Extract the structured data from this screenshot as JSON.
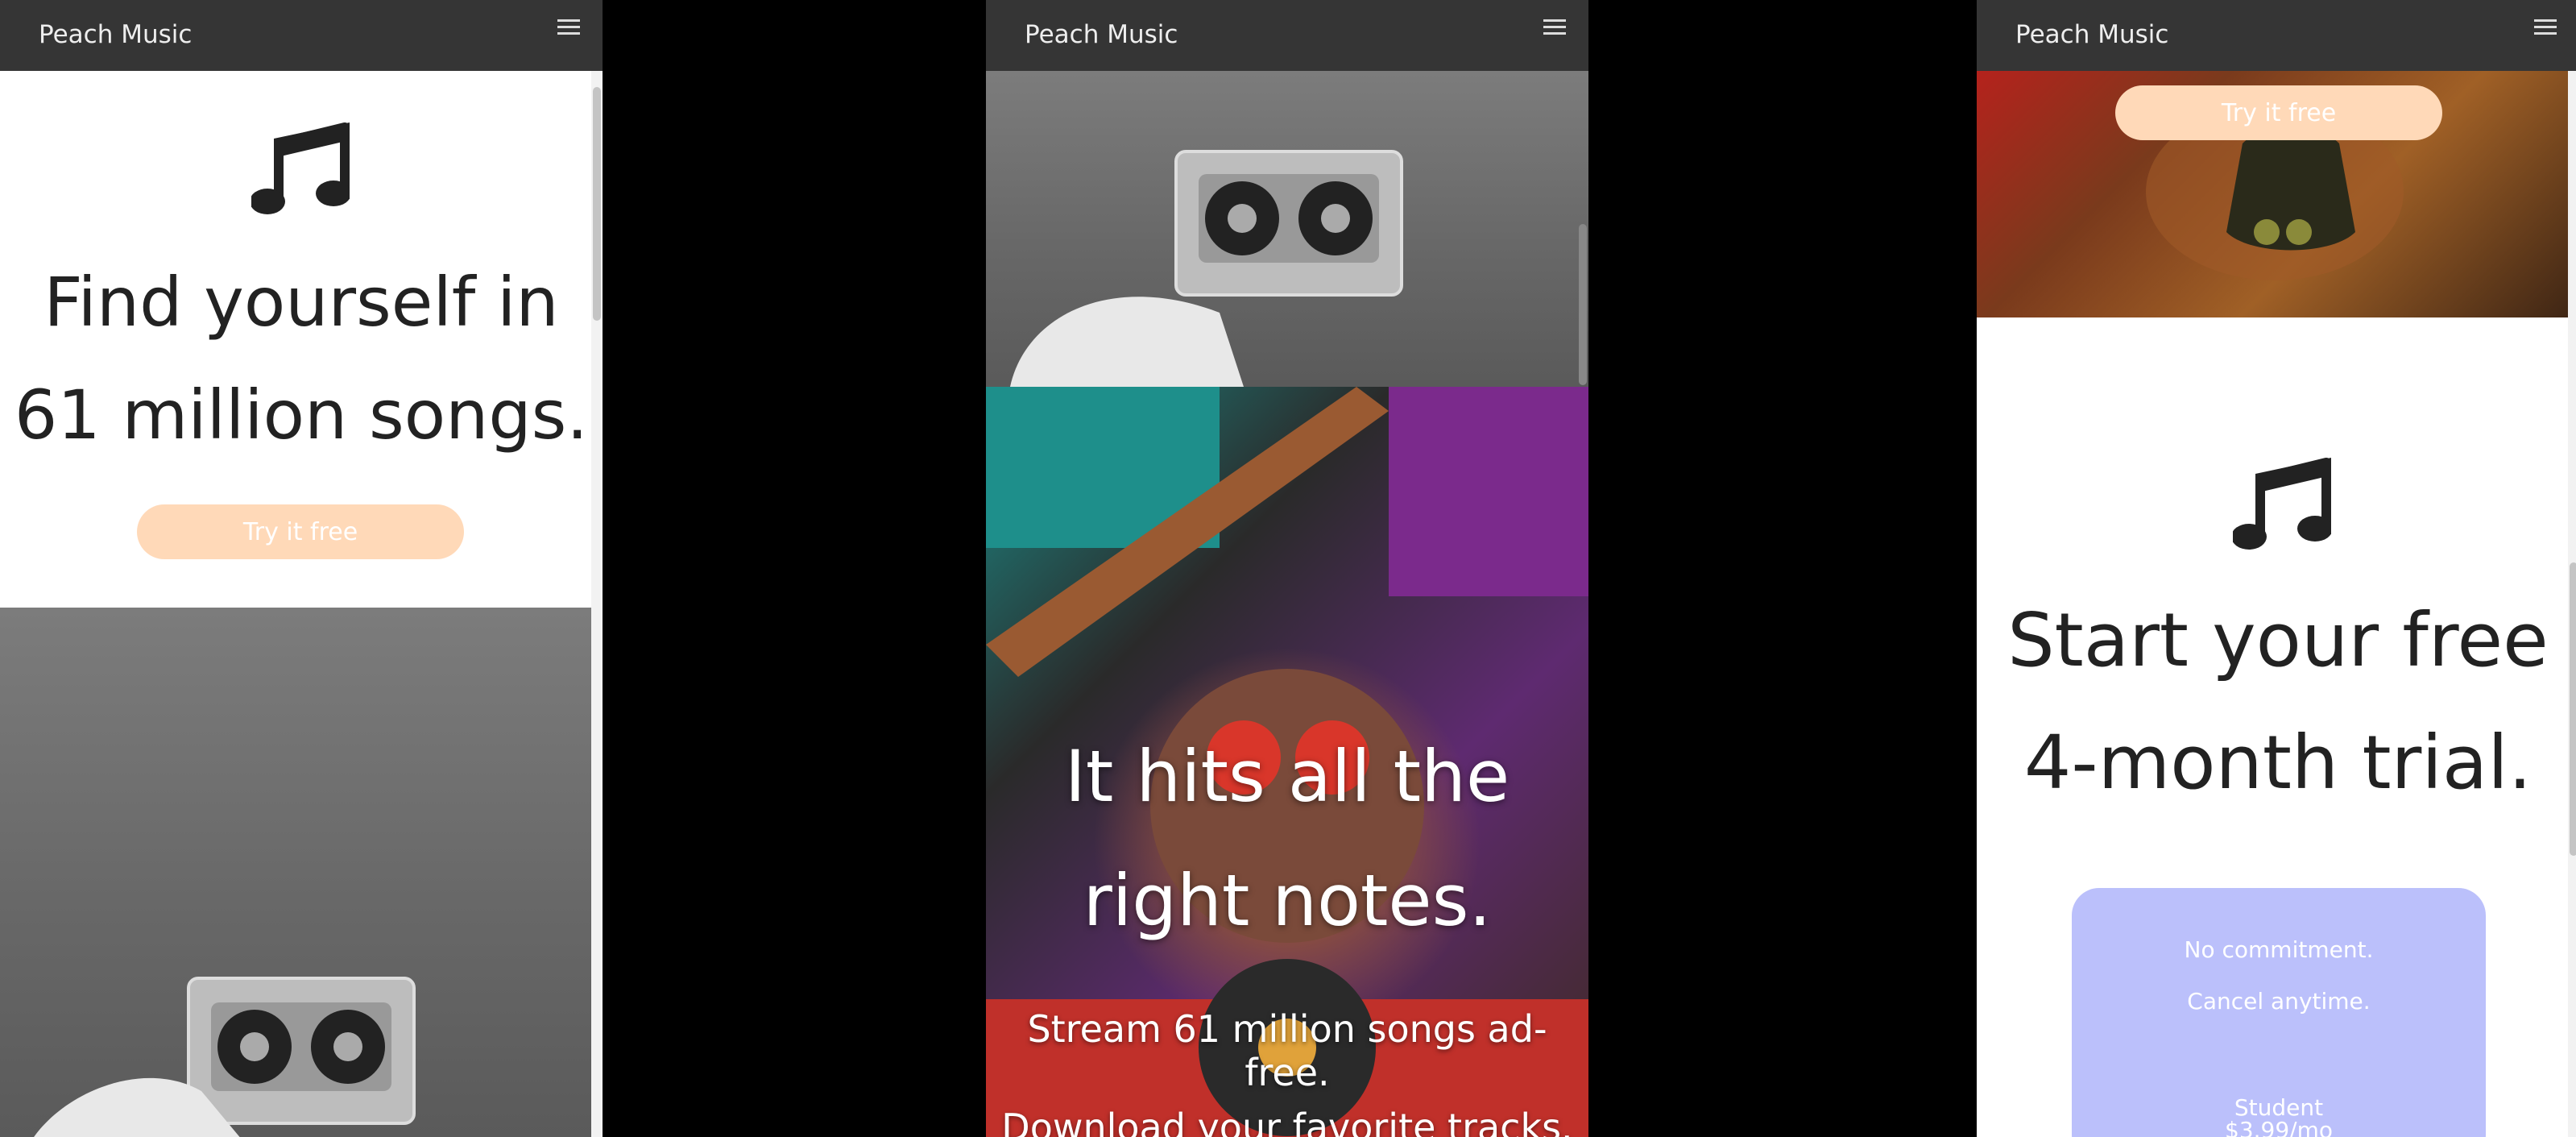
{
  "panels": [
    {
      "brand": "Peach Music",
      "hero_title_line1": "Find yourself in",
      "hero_title_line2": "61 million songs.",
      "cta_label": "Try it free"
    },
    {
      "brand": "Peach Music",
      "overlay_title_line1": "It hits all the",
      "overlay_title_line2": "right notes.",
      "sub_line1": "Stream 61 million songs ad-free.",
      "sub_line2": "Download your favorite tracks."
    },
    {
      "brand": "Peach Music",
      "cta_label": "Try it free",
      "hero_title_line1": "Start your free",
      "hero_title_line2": "4-month trial.",
      "plan_line1": "No commitment.",
      "plan_line2": "Cancel anytime.",
      "plan_name": "Student",
      "plan_price": "$3.99/mo"
    }
  ],
  "colors": {
    "navbar": "#353535",
    "accent_button": "#ffd9b8",
    "plan_card": "#bbc0fb",
    "text_dark": "#222222"
  },
  "icons": [
    "hamburger-icon",
    "music-note-icon",
    "cassette-image"
  ]
}
